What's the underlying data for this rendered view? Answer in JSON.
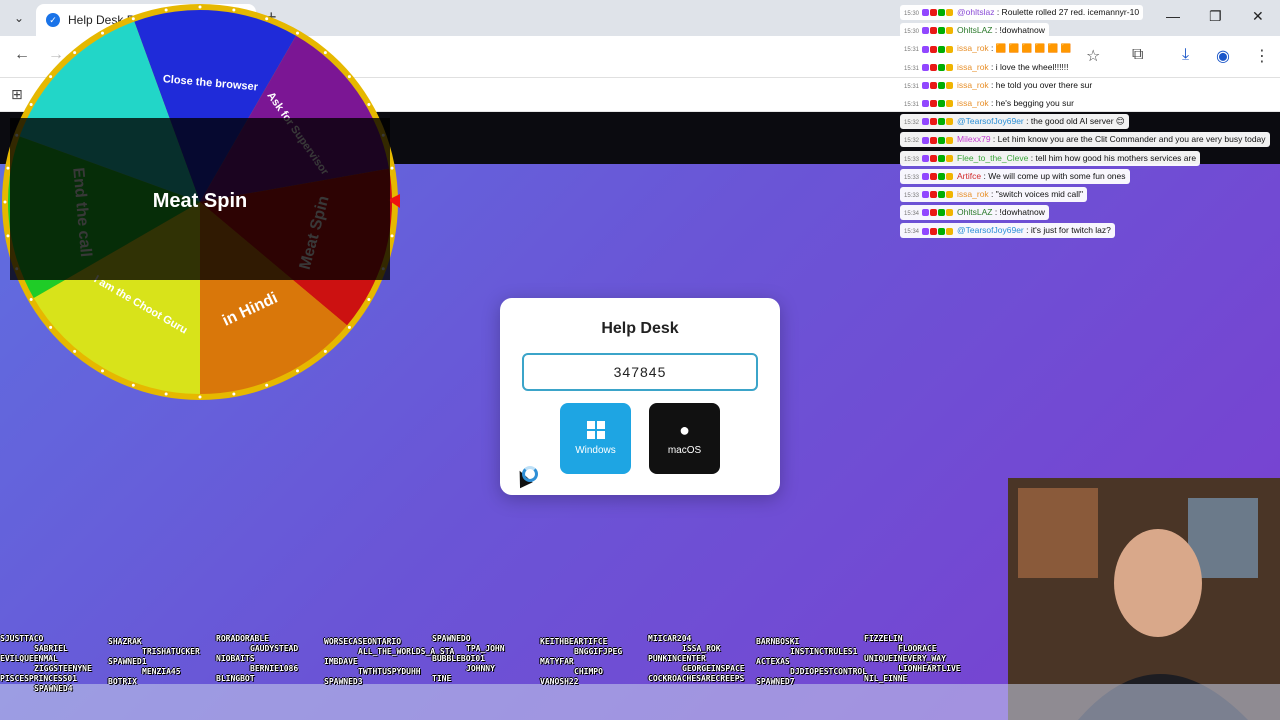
{
  "browser": {
    "tab_title": "Help Desk P",
    "tab_favicon": "check-shield-icon",
    "controls": {
      "minimize": "—",
      "maximize": "❐",
      "close": "✕"
    }
  },
  "wheel": {
    "segments": [
      {
        "label": "Close the browser",
        "color": "#1f2bd9"
      },
      {
        "label": "Ask for Supervisor",
        "color": "#7b1694"
      },
      {
        "label": "Meat Spin",
        "color": "#cc1111"
      },
      {
        "label": "in Hindi",
        "color": "#d9770a"
      },
      {
        "label": "I am the Choot Guru",
        "color": "#d8e31a"
      },
      {
        "label": "End the call",
        "color": "#1fcc27"
      },
      {
        "label": "",
        "color": "#22d6c8"
      }
    ],
    "result": "Meat Spin"
  },
  "helpdesk": {
    "title": "Help Desk",
    "code": "347845",
    "windows_label": "Windows",
    "mac_label": "macOS"
  },
  "chat": [
    {
      "time": "15:30",
      "user": "@ohltslaz",
      "user_color": "#8a4bd6",
      "text": "Roulette rolled 27 red. icemannyr-10"
    },
    {
      "time": "15:30",
      "user": "OhltsLAZ",
      "user_color": "#2b7a2b",
      "text": "!dowhatnow"
    },
    {
      "time": "15:31",
      "user": "issa_rok",
      "user_color": "#e8902a",
      "text": "🟧 🟧 🟧 🟧 🟧 🟧"
    },
    {
      "time": "15:31",
      "user": "issa_rok",
      "user_color": "#e8902a",
      "text": "i love the wheel!!!!!!"
    },
    {
      "time": "15:31",
      "user": "issa_rok",
      "user_color": "#e8902a",
      "text": "he told you over there sur"
    },
    {
      "time": "15:31",
      "user": "issa_rok",
      "user_color": "#e8902a",
      "text": "he's begging you sur"
    },
    {
      "time": "15:32",
      "user": "@TearsofJoy69er",
      "user_color": "#2a8fd6",
      "text": "the good old AI server 😊"
    },
    {
      "time": "15:32",
      "user": "Milexx79",
      "user_color": "#c23ad1",
      "text": "Let him know you are the Clit Commander and you are very busy today"
    },
    {
      "time": "15:33",
      "user": "Flee_to_the_Cleve",
      "user_color": "#3aa63a",
      "text": "tell him how good his mothers services are"
    },
    {
      "time": "15:33",
      "user": "Artifce",
      "user_color": "#d12a2a",
      "text": "We will come up with some fun ones"
    },
    {
      "time": "15:33",
      "user": "issa_rok",
      "user_color": "#e8902a",
      "text": "\"switch voices mid call\""
    },
    {
      "time": "15:34",
      "user": "OhltsLAZ",
      "user_color": "#2b7a2b",
      "text": "!dowhatnow"
    },
    {
      "time": "15:34",
      "user": "@TearsofJoy69er",
      "user_color": "#2a8fd6",
      "text": "it's just for twitch laz?"
    }
  ],
  "viewers": [
    "SJUSTTACO",
    "SHAZRAK",
    "RORADORABLE",
    "WORSECASEONTARIO",
    "SPAWNEDO",
    "KEITHBEARTIFCE",
    "MIICAR204",
    "BARNBOSKI",
    "FIZZELIN",
    "SABRIEL",
    "TRISHATUCKER",
    "GAUDYSTEAD",
    "ALL_THE_WORLDS_A_STA",
    "TPA_JOHN",
    "BNGGIFJPEG",
    "ISSA_ROK",
    "INSTINCTRULES1",
    "FLOORACE",
    "EVILQUEENMAL",
    "SPAWNED1",
    "NIOBAITS",
    "IMBDAVE",
    "BUBBLEBOI01",
    "MATYFAR",
    "PUNKINCENTER",
    "ACTEXAS",
    "UNIQUEINEVERY_WAY",
    "ZIGGSTEENYNE",
    "MENZIA45",
    "BERNIE1086",
    "TWTHTUSPYDUHH",
    "JOHNNY",
    "CHIMPO",
    "GEORGEINSPACE",
    "DJDIOPESTCONTROL",
    "LIONHEARTLIVE",
    "PISCESPRINCESS01",
    "BOTRIX",
    "BLINGBOT",
    "SPAWNED3",
    "TINE",
    "VANOSH22",
    "COCKROACHESARECREEPS",
    "SPAWNED7",
    "NIL_EINNE",
    "SPAWNED4"
  ]
}
